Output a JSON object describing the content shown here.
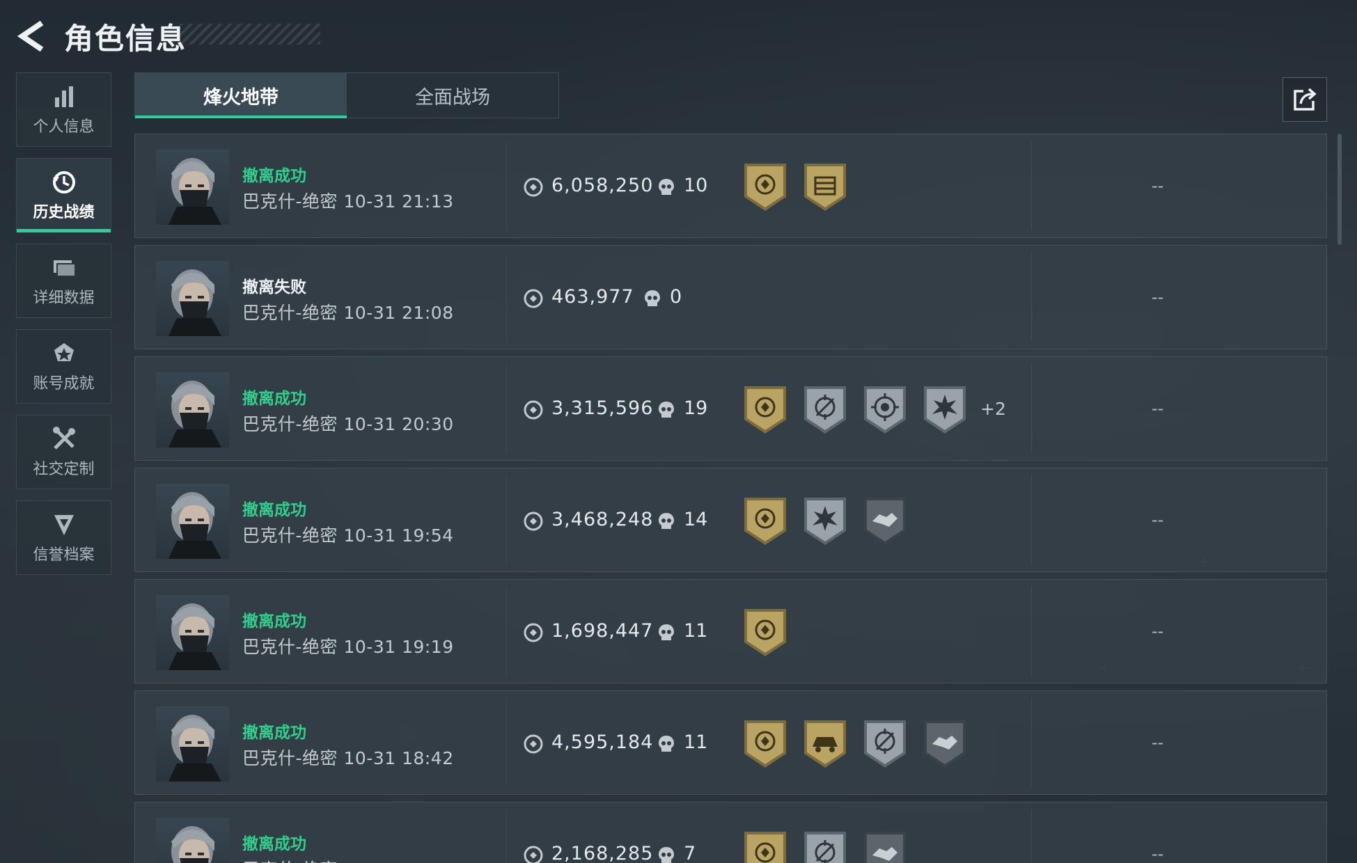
{
  "header": {
    "title": "角色信息"
  },
  "sidebar": {
    "items": [
      {
        "label": "个人信息",
        "icon": "bar-chart-icon"
      },
      {
        "label": "历史战绩",
        "icon": "history-clock-icon",
        "active": true
      },
      {
        "label": "详细数据",
        "icon": "folder-icon"
      },
      {
        "label": "账号成就",
        "icon": "achievement-icon"
      },
      {
        "label": "社交定制",
        "icon": "tools-icon"
      },
      {
        "label": "信誉档案",
        "icon": "credit-shield-icon"
      }
    ]
  },
  "tabs": [
    {
      "label": "烽火地带",
      "active": true
    },
    {
      "label": "全面战场"
    }
  ],
  "share": {
    "icon": "share-icon"
  },
  "matches": [
    {
      "status": "撤离成功",
      "map": "巴克什-绝密",
      "time": "10-31 21:13",
      "value": "6,058,250",
      "kills": "10",
      "medals": [
        "gold-shield",
        "gold-crate"
      ],
      "more": "",
      "extra": "--"
    },
    {
      "status": "撤离失败",
      "map": "巴克什-绝密",
      "time": "10-31 21:08",
      "value": "463,977",
      "kills": "0",
      "medals": [],
      "more": "",
      "extra": "--"
    },
    {
      "status": "撤离成功",
      "map": "巴克什-绝密",
      "time": "10-31 20:30",
      "value": "3,315,596",
      "kills": "19",
      "medals": [
        "gold-shield",
        "silver-crosshair",
        "silver-target",
        "silver-burst"
      ],
      "more": "+2",
      "extra": "--"
    },
    {
      "status": "撤离成功",
      "map": "巴克什-绝密",
      "time": "10-31 19:54",
      "value": "3,468,248",
      "kills": "14",
      "medals": [
        "gold-shield",
        "silver-burst",
        "dark-handshake"
      ],
      "more": "",
      "extra": "--"
    },
    {
      "status": "撤离成功",
      "map": "巴克什-绝密",
      "time": "10-31 19:19",
      "value": "1,698,447",
      "kills": "11",
      "medals": [
        "gold-shield"
      ],
      "more": "",
      "extra": "--"
    },
    {
      "status": "撤离成功",
      "map": "巴克什-绝密",
      "time": "10-31 18:42",
      "value": "4,595,184",
      "kills": "11",
      "medals": [
        "gold-shield",
        "gold-vehicle",
        "silver-crosshair",
        "dark-handshake"
      ],
      "more": "",
      "extra": "--"
    },
    {
      "status": "撤离成功",
      "map": "巴克什-绝密",
      "time": "",
      "value": "2,168,285",
      "kills": "7",
      "medals": [
        "gold-shield",
        "silver-crosshair",
        "dark-handshake"
      ],
      "more": "",
      "extra": "--"
    }
  ],
  "colors": {
    "success": "#2fd08e",
    "accent": "#29d29a",
    "gold": "#b9a463",
    "silver": "#8d969c"
  }
}
